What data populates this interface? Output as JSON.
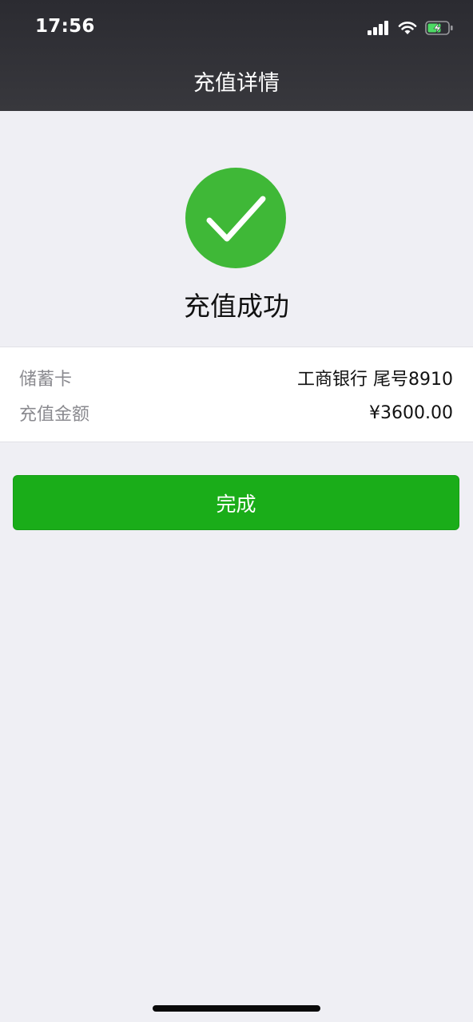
{
  "status_bar": {
    "time": "17:56",
    "icons": [
      "signal-icon",
      "wifi-icon",
      "battery-charging-icon"
    ]
  },
  "header": {
    "title": "充值详情"
  },
  "result": {
    "icon": "check-circle-icon",
    "title": "充值成功",
    "color": "#3fb837"
  },
  "details": {
    "rows": [
      {
        "label": "储蓄卡",
        "value": "工商银行 尾号8910"
      },
      {
        "label": "充值金额",
        "value": "¥3600.00"
      }
    ]
  },
  "actions": {
    "done_label": "完成",
    "button_color": "#1aad19"
  }
}
